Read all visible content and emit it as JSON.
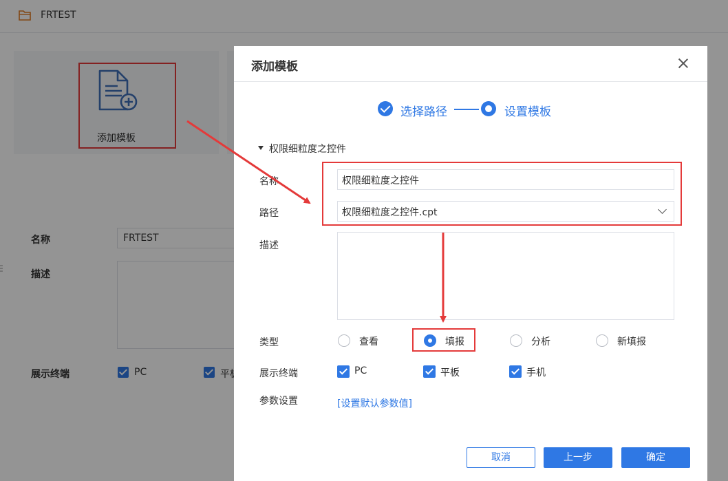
{
  "background": {
    "header_title": "FRTEST",
    "card_label": "添加模板",
    "form": {
      "name_label": "名称",
      "name_value": "FRTEST",
      "desc_label": "描述",
      "terminal_label": "展示终端",
      "terminal_pc": "PC",
      "terminal_tablet": "平板"
    }
  },
  "dialog": {
    "title": "添加模板",
    "steps": [
      {
        "label": "选择路径",
        "state": "done"
      },
      {
        "label": "设置模板",
        "state": "current"
      }
    ],
    "section_title": "权限细粒度之控件",
    "fields": {
      "name_label": "名称",
      "name_value": "权限细粒度之控件",
      "path_label": "路径",
      "path_value": "权限细粒度之控件.cpt",
      "desc_label": "描述",
      "desc_value": "",
      "type_label": "类型",
      "type_options": [
        {
          "label": "查看",
          "selected": false
        },
        {
          "label": "填报",
          "selected": true
        },
        {
          "label": "分析",
          "selected": false
        },
        {
          "label": "新填报",
          "selected": false
        }
      ],
      "terminal_label": "展示终端",
      "terminal_options": [
        {
          "label": "PC",
          "checked": true
        },
        {
          "label": "平板",
          "checked": true
        },
        {
          "label": "手机",
          "checked": true
        }
      ],
      "param_label": "参数设置",
      "param_link": "[设置默认参数值]"
    },
    "buttons": {
      "cancel": "取消",
      "prev": "上一步",
      "ok": "确定"
    }
  },
  "colors": {
    "accent": "#2f78e4",
    "annotation": "#e43a3a"
  }
}
